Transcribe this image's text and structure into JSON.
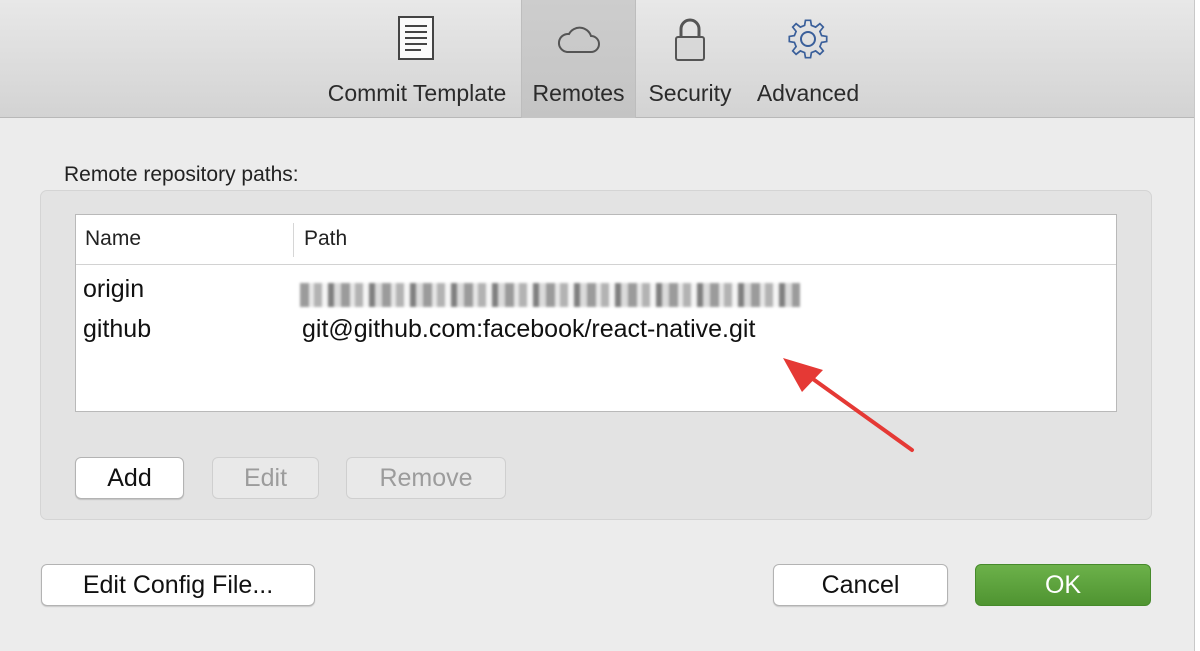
{
  "toolbar": {
    "tabs": [
      {
        "label": "Commit Template",
        "icon": "document-icon",
        "active": false
      },
      {
        "label": "Remotes",
        "icon": "cloud-icon",
        "active": true
      },
      {
        "label": "Security",
        "icon": "lock-icon",
        "active": false
      },
      {
        "label": "Advanced",
        "icon": "gear-icon",
        "active": false
      }
    ]
  },
  "remotes": {
    "section_label": "Remote repository paths:",
    "columns": [
      "Name",
      "Path"
    ],
    "rows": [
      {
        "name": "origin",
        "path": ""
      },
      {
        "name": "github",
        "path": "git@github.com:facebook/react-native.git"
      }
    ],
    "buttons": {
      "add": "Add",
      "edit": "Edit",
      "remove": "Remove"
    }
  },
  "footer": {
    "edit_config": "Edit Config File...",
    "cancel": "Cancel",
    "ok": "OK"
  },
  "colors": {
    "accent_ok": "#5aa23b",
    "annotation_arrow": "#e53935"
  }
}
